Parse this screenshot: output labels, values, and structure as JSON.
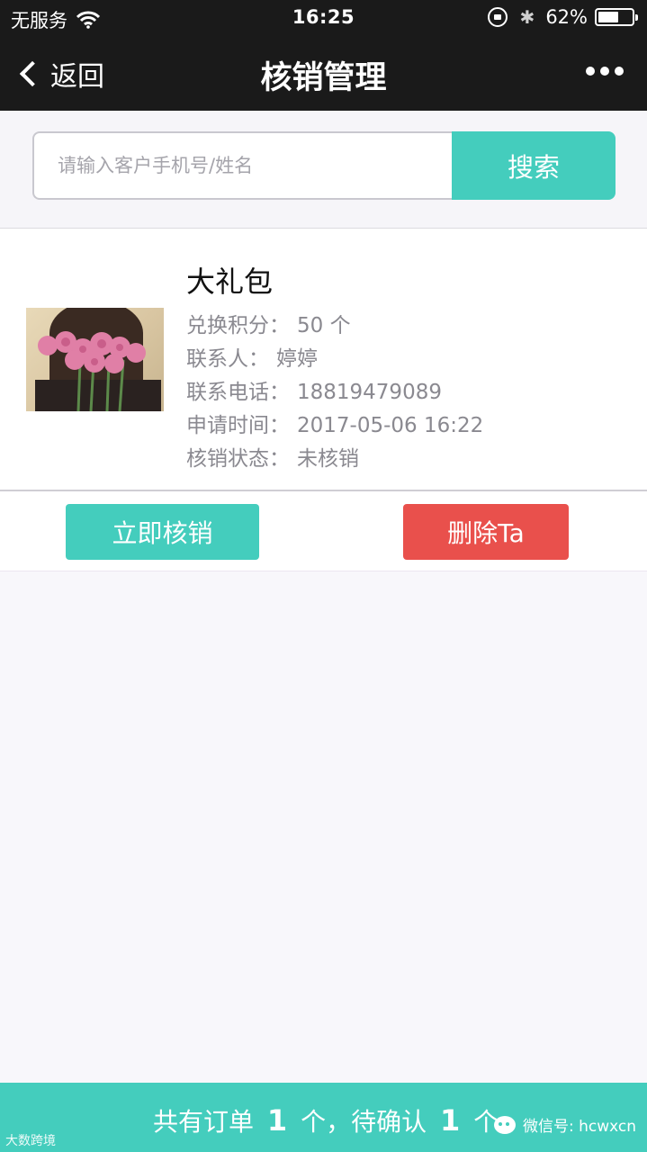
{
  "status_bar": {
    "carrier": "无服务",
    "time": "16:25",
    "battery_text": "62%",
    "battery_level": 0.62,
    "bluetooth_icon": "bluetooth-icon",
    "wifi_icon": "wifi-icon",
    "rotation_lock_icon": "rotation-lock-icon"
  },
  "nav": {
    "back_label": "返回",
    "title": "核销管理",
    "more_icon": "more-dots-icon"
  },
  "search": {
    "placeholder": "请输入客户手机号/姓名",
    "value": "",
    "button_label": "搜索"
  },
  "order": {
    "title": "大礼包",
    "fields": [
      {
        "label": "兑换积分：",
        "value": "50 个"
      },
      {
        "label": "联系人：",
        "value": "婷婷"
      },
      {
        "label": "联系电话：",
        "value": "18819479089"
      },
      {
        "label": "申请时间：",
        "value": "2017-05-06 16:22"
      },
      {
        "label": "核销状态：",
        "value": "未核销"
      }
    ],
    "verify_button": "立即核销",
    "delete_button": "删除Ta"
  },
  "footer": {
    "prefix": "共有订单",
    "order_count": "1",
    "middle": "个，待确认",
    "pending_count": "1",
    "suffix": "个",
    "watermark_left": "大数跨境",
    "watermark_right": "微信号: hcwxcn"
  },
  "colors": {
    "accent": "#44cdbd",
    "danger": "#e9504c",
    "header": "#1a1a1a"
  }
}
